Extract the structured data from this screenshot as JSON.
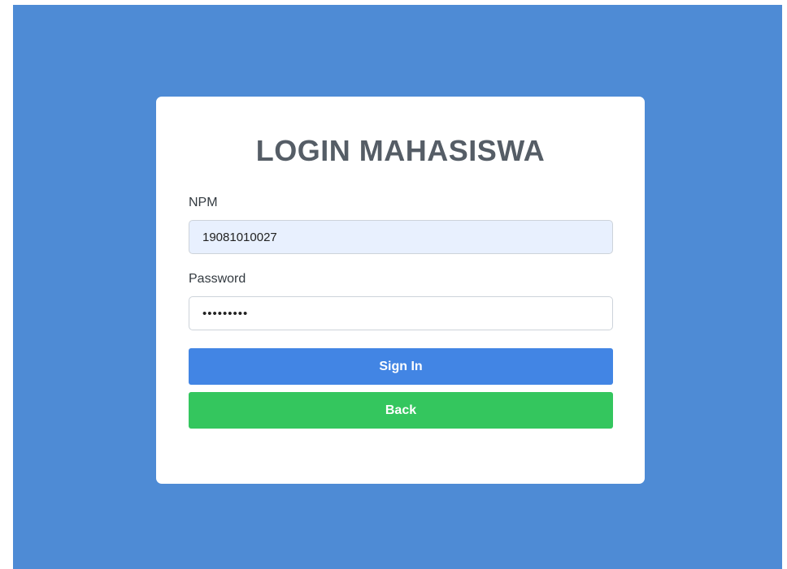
{
  "login": {
    "title": "LOGIN MAHASISWA",
    "npm_label": "NPM",
    "npm_value": "19081010027",
    "password_label": "Password",
    "password_value": "•••••••••",
    "signin_label": "Sign In",
    "back_label": "Back"
  },
  "colors": {
    "background": "#4e8bd5",
    "card": "#ffffff",
    "signin_button": "#4285e4",
    "back_button": "#34c65e",
    "autofill_input": "#e8f0fe"
  }
}
